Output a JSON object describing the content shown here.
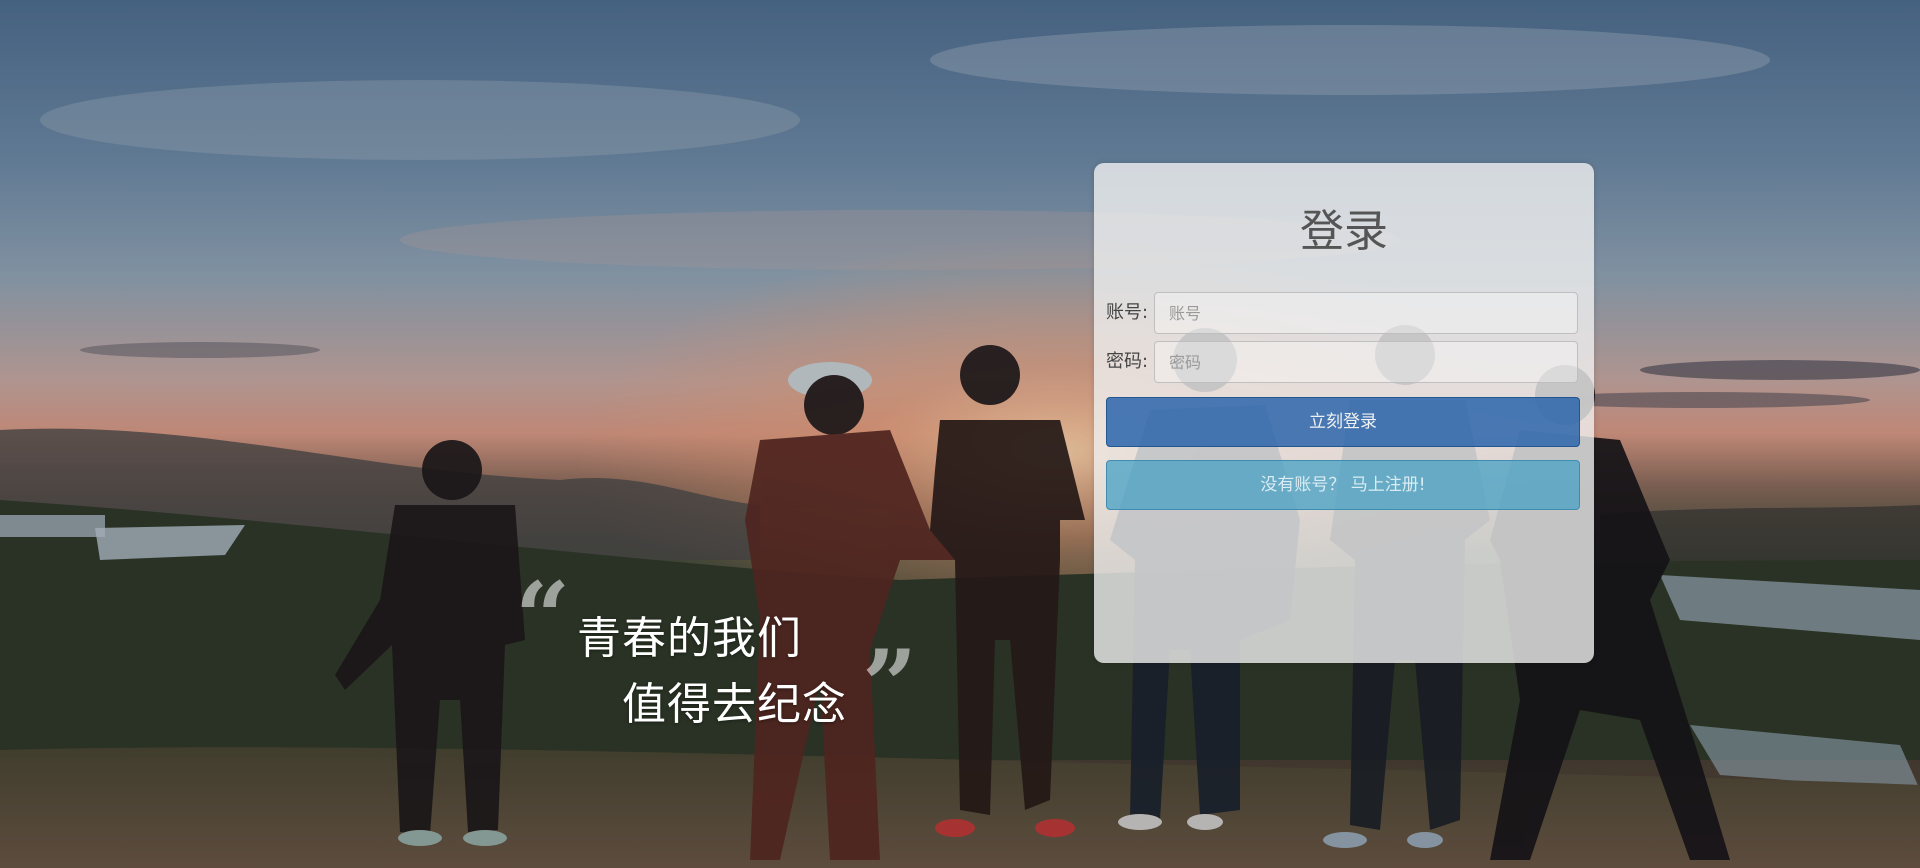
{
  "quote": {
    "open_mark": "“",
    "line1": "青春的我们",
    "line2": "值得去纪念",
    "close_mark": "”"
  },
  "login": {
    "title": "登录",
    "account_label": "账号:",
    "account_placeholder": "账号",
    "account_value": "",
    "password_label": "密码:",
    "password_placeholder": "密码",
    "password_value": "",
    "login_button": "立刻登录",
    "register_button": "没有账号？  马上注册!"
  },
  "colors": {
    "login_button": "#2c65ab",
    "register_button": "#46a0c4",
    "card": "#f0f0f0"
  }
}
